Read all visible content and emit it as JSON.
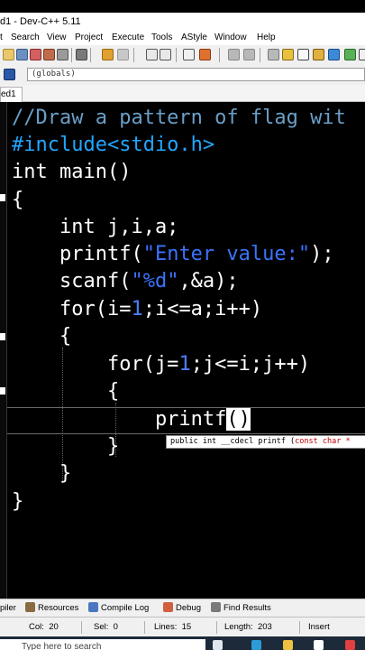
{
  "window": {
    "title": "d1 - Dev-C++ 5.11"
  },
  "menu": [
    "t",
    "Search",
    "View",
    "Project",
    "Execute",
    "Tools",
    "AStyle",
    "Window",
    "Help"
  ],
  "toolbar": {
    "globals_value": "(globals)"
  },
  "tabs": [
    {
      "label": "ed1"
    }
  ],
  "code_lines": [
    "//Draw a pattern of flag wit",
    "#include<stdio.h>",
    "int main()",
    "{",
    "    int j,i,a;",
    "    printf(\"Enter value:\");",
    "    scanf(\"%d\",&a);",
    "    for(i=1;i<=a;i++)",
    "    {",
    "        for(j=1;j<=i;j++)",
    "        {",
    "            printf()",
    "        }",
    "    }",
    "}"
  ],
  "tooltip": {
    "text": "public int __cdecl printf (const char *"
  },
  "bottom_tabs": [
    "piler",
    "Resources",
    "Compile Log",
    "Debug",
    "Find Results"
  ],
  "status": {
    "col_label": "Col:",
    "col_value": "20",
    "sel_label": "Sel:",
    "sel_value": "0",
    "lines_label": "Lines:",
    "lines_value": "15",
    "length_label": "Length:",
    "length_value": "203",
    "mode": "Insert"
  },
  "taskbar": {
    "search_placeholder": "Type here to search"
  },
  "colors": {
    "comment": "#6a9fc8",
    "preprocessor": "#22a6ff",
    "string": "#3b73ff",
    "number": "#4e7dff",
    "editor_bg": "#000000"
  }
}
